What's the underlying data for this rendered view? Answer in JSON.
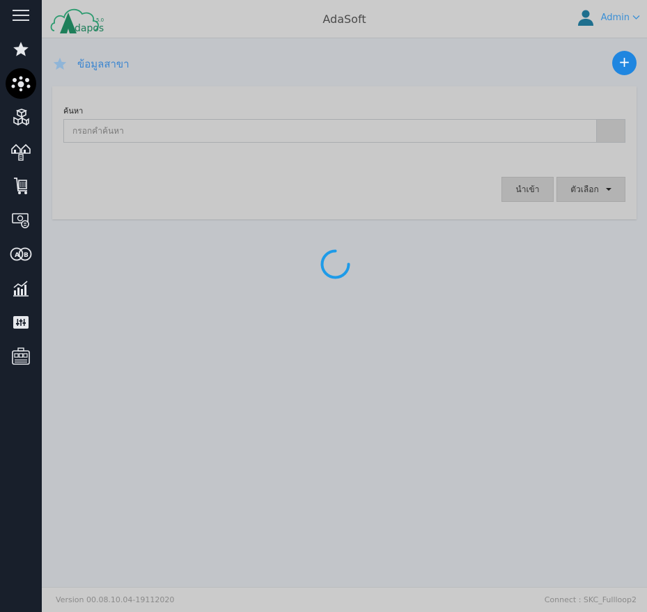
{
  "app": {
    "title": "AdaSoft",
    "logo_text": "Adapos",
    "logo_super": "5.0"
  },
  "user": {
    "name": "Admin"
  },
  "sidebar": {
    "items": [
      {
        "icon": "hamburger-menu-icon"
      },
      {
        "icon": "star-icon"
      },
      {
        "icon": "paw-network-icon",
        "active": true
      },
      {
        "icon": "boxes-icon"
      },
      {
        "icon": "branch-stores-icon"
      },
      {
        "icon": "shopping-cart-icon"
      },
      {
        "icon": "money-icon"
      },
      {
        "icon": "ab-compare-icon"
      },
      {
        "icon": "bar-chart-icon"
      },
      {
        "icon": "settings-sliders-icon"
      },
      {
        "icon": "pos-machines-icon"
      }
    ]
  },
  "page": {
    "title": "ข้อมูลสาขา",
    "add_label": "+"
  },
  "search": {
    "label": "ค้นหา",
    "placeholder": "กรอกคำค้นหา",
    "value": ""
  },
  "buttons": {
    "import_label": "นำเข้า",
    "options_label": "ตัวเลือก"
  },
  "footer": {
    "version": "Version 00.08.10.04-19112020",
    "connect": "Connect : SKC_Fullloop2"
  },
  "colors": {
    "accent": "#1f86e0",
    "sidebar_bg": "#181f2b",
    "spinner": "#1e9be8"
  }
}
